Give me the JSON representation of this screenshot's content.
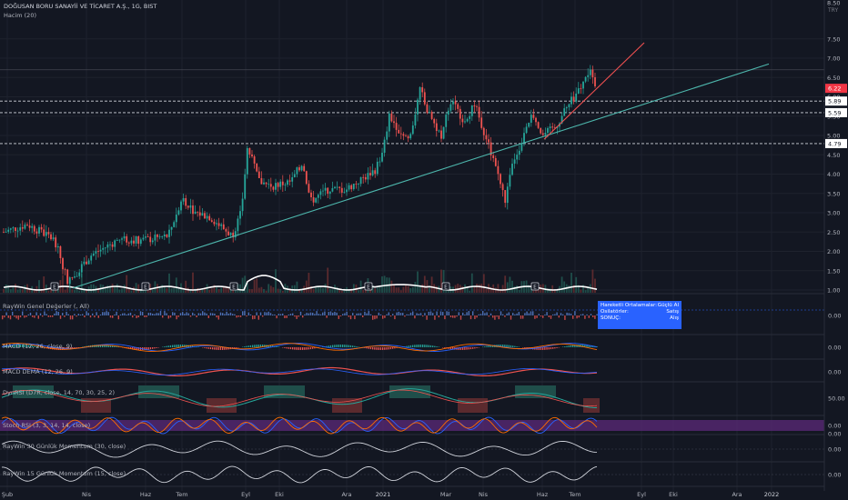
{
  "header": {
    "symbol": "DOĞUSAN BORU SANAYİİ VE TİCARET A.Ş., 1G, BIST",
    "indicator": "Hacim (20)"
  },
  "currency": "TRY",
  "price_axis": {
    "ticks": [
      "8.50",
      "7.50",
      "7.00",
      "6.50",
      "6.00",
      "5.50",
      "5.00",
      "4.50",
      "4.00",
      "3.50",
      "3.00",
      "2.50",
      "2.00",
      "1.50",
      "1.00"
    ],
    "badges": [
      {
        "value": "6.22",
        "bg": "#f23645",
        "fg": "#ffffff"
      },
      {
        "value": "5.89",
        "bg": "#ffffff",
        "fg": "#131722"
      },
      {
        "value": "5.59",
        "bg": "#ffffff",
        "fg": "#131722"
      },
      {
        "value": "4.79",
        "bg": "#ffffff",
        "fg": "#131722"
      }
    ]
  },
  "time_axis": [
    "Şub",
    "Nis",
    "Haz",
    "Tem",
    "Eyl",
    "Eki",
    "Ara",
    "2021",
    "Mar",
    "Nis",
    "Haz",
    "Tem",
    "Eyl",
    "Eki",
    "Ara",
    "2022"
  ],
  "event_markers": [
    "E",
    "E",
    "E",
    "E",
    "E",
    "E"
  ],
  "panes": [
    {
      "label": "RayWin Genel Değerler (, All)",
      "ticks": [
        "0.00"
      ]
    },
    {
      "label": "MACD (12, 26, close, 9)",
      "ticks": [
        "0.00"
      ]
    },
    {
      "label": "MACD DEMA (12, 26, 9)",
      "ticks": [
        "0.00"
      ]
    },
    {
      "label": "DynRSI (D7R, close, 14, 70, 30, 25, 2)",
      "ticks": [
        "50.00"
      ]
    },
    {
      "label": "Stoch RSI (3, 3, 14, 14, close)",
      "ticks": [
        "0.00"
      ]
    },
    {
      "label": "RayWin 30 Günlük Momentum (30, close)",
      "ticks": [
        "0.00",
        "0.00"
      ]
    },
    {
      "label": "RayWin 15 Günlük Momentum (15, close)",
      "ticks": [
        "0.00"
      ]
    }
  ],
  "summary_box": {
    "rows": [
      {
        "key": "Hareketli Ortalamalar:",
        "value": "Güçlü Al"
      },
      {
        "key": "Osilatörler:",
        "value": "Satış"
      },
      {
        "key": "SONUÇ:",
        "value": "Alış"
      }
    ]
  },
  "colors": {
    "background": "#131722",
    "up": "#26a69a",
    "down": "#ef5350",
    "trendline": "#4db6ac",
    "trendline2": "#f05050",
    "accent": "#2962ff",
    "stoch_band": "#5c2a7a"
  },
  "chart_data": {
    "type": "candlestick",
    "symbol": "DOĞUSAN BORU SANAYİİ VE TİCARET A.Ş.",
    "timeframe": "1G",
    "ylim": [
      1.0,
      8.5
    ],
    "x": [
      "Şub",
      "Nis",
      "Haz",
      "Tem",
      "Eyl",
      "Eki",
      "Ara",
      "2021",
      "Mar",
      "Nis",
      "Haz",
      "Tem"
    ],
    "close_approx": [
      2.5,
      1.3,
      2.4,
      3.2,
      3.6,
      3.7,
      3.7,
      5.4,
      5.2,
      3.6,
      5.2,
      6.22
    ],
    "last_price": 6.22,
    "horizontal_levels": [
      5.89,
      5.59,
      4.79
    ]
  }
}
